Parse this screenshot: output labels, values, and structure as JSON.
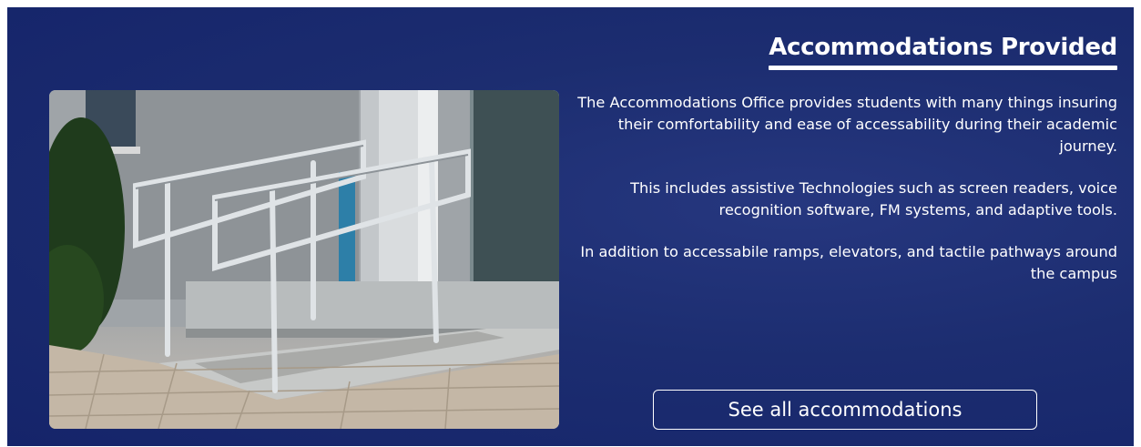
{
  "section": {
    "heading": "Accommodations Provided",
    "paragraphs": [
      "The Accommodations Office provides students with many things insuring their comfortability and ease of accessability during their academic journey.",
      "This includes assistive Technologies such as screen readers, voice recognition software, FM systems, and adaptive tools.",
      "In addition to accessabile ramps, elevators, and tactile pathways around the campus"
    ],
    "cta_label": "See all accommodations"
  },
  "image": {
    "subject": "wheelchair-ramp-with-stainless-handrails"
  },
  "colors": {
    "background": "#1c2d70",
    "text": "#ffffff",
    "button_border": "#ffffff"
  }
}
